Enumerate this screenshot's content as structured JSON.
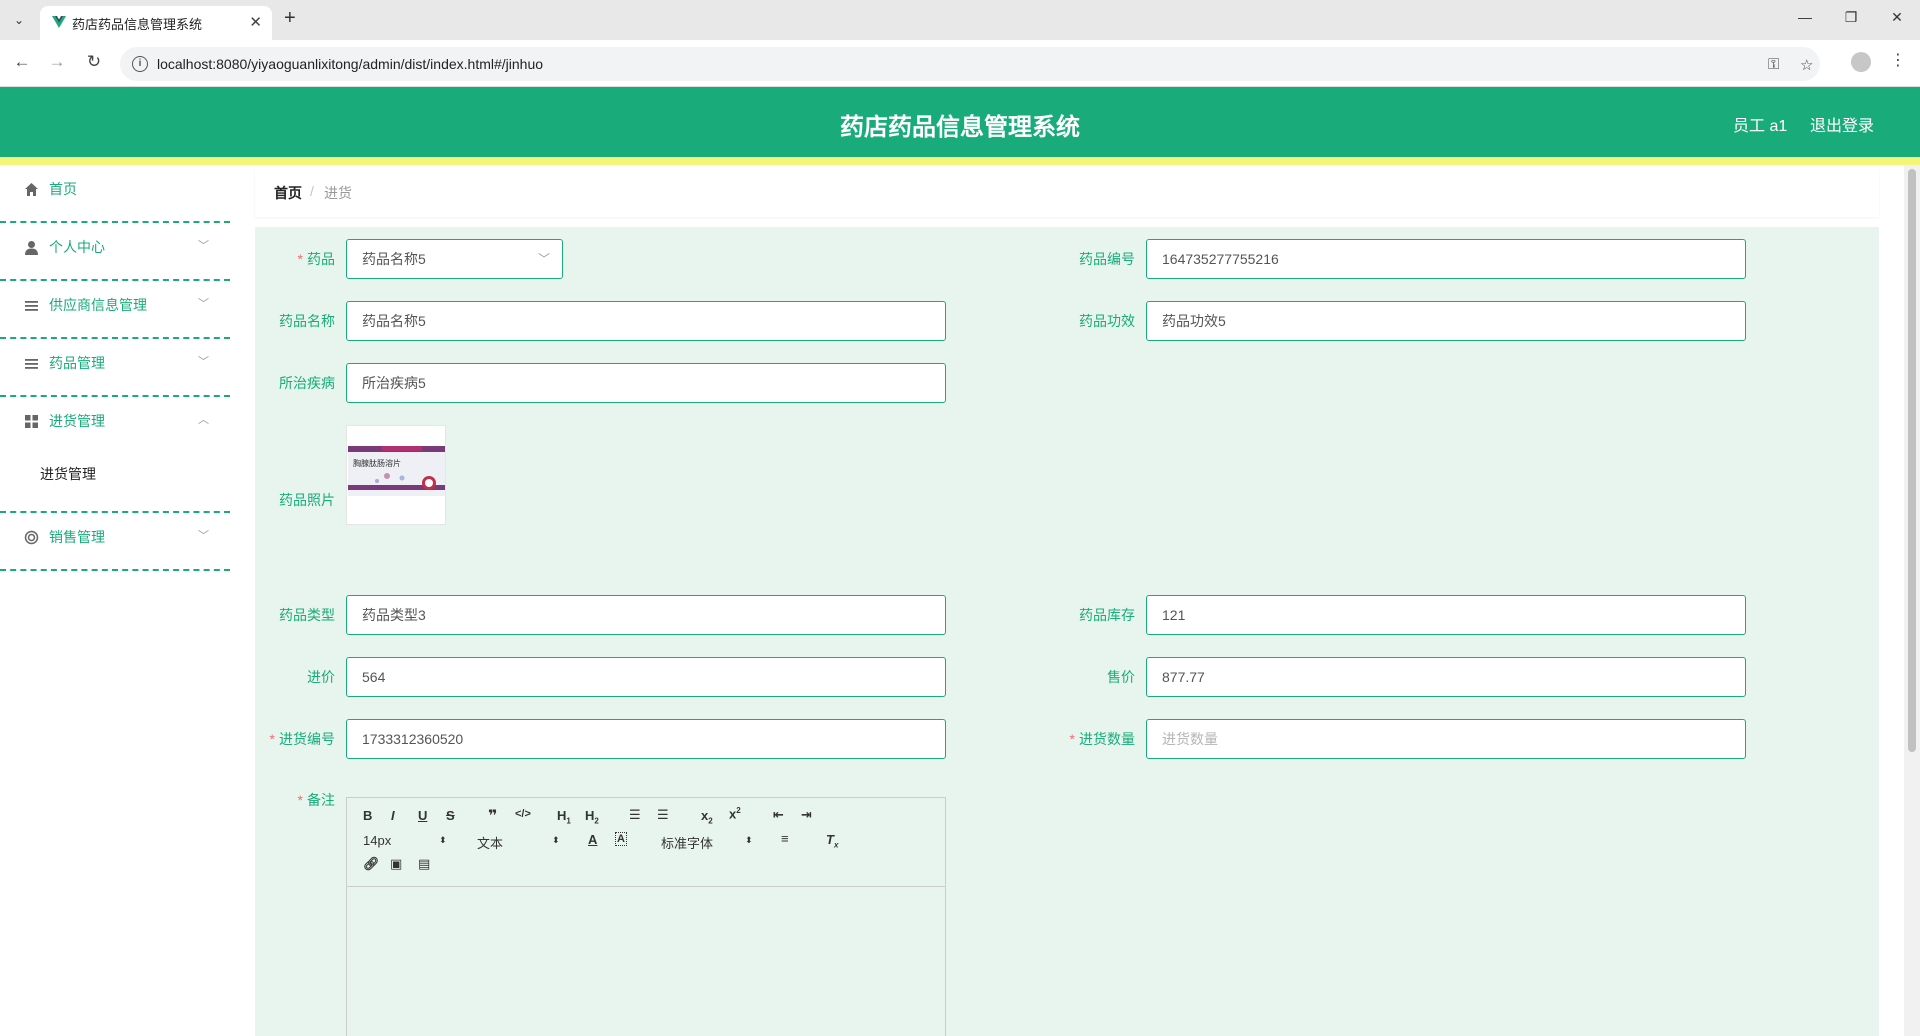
{
  "browser": {
    "tab_title": "药店药品信息管理系统",
    "url": "localhost:8080/yiyaoguanlixitong/admin/dist/index.html#/jinhuo"
  },
  "header": {
    "title": "药店药品信息管理系统",
    "user": "员工 a1",
    "logout": "退出登录"
  },
  "sidebar": {
    "items": [
      {
        "label": "首页",
        "icon": "home-icon"
      },
      {
        "label": "个人中心",
        "icon": "user-icon"
      },
      {
        "label": "供应商信息管理",
        "icon": "menu-icon"
      },
      {
        "label": "药品管理",
        "icon": "menu-icon"
      },
      {
        "label": "进货管理",
        "icon": "grid-icon",
        "expanded": true
      },
      {
        "label": "销售管理",
        "icon": "circle-icon"
      }
    ],
    "submenu": {
      "label": "进货管理"
    }
  },
  "breadcrumb": {
    "home": "首页",
    "sep": "/",
    "current": "进货"
  },
  "form": {
    "drug": {
      "label": "药品",
      "value": "药品名称5"
    },
    "drug_no": {
      "label": "药品编号",
      "value": "164735277755216"
    },
    "drug_name": {
      "label": "药品名称",
      "value": "药品名称5"
    },
    "efficacy": {
      "label": "药品功效",
      "value": "药品功效5"
    },
    "disease": {
      "label": "所治疾病",
      "value": "所治疾病5"
    },
    "photo": {
      "label": "药品照片",
      "product_text": "胸腺肽肠溶片"
    },
    "drug_type": {
      "label": "药品类型",
      "value": "药品类型3"
    },
    "stock": {
      "label": "药品库存",
      "value": "121"
    },
    "cost": {
      "label": "进价",
      "value": "564"
    },
    "price": {
      "label": "售价",
      "value": "877.77"
    },
    "purchase_no": {
      "label": "进货编号",
      "value": "1733312360520"
    },
    "purchase_qty": {
      "label": "进货数量",
      "placeholder": "进货数量"
    },
    "remark": {
      "label": "备注"
    }
  },
  "editor": {
    "font_size": "14px",
    "text_style": "文本",
    "font_family": "标准字体"
  },
  "colors": {
    "primary": "#1aab7a",
    "stripe": "#f5f57a",
    "panel": "#e8f5ef"
  }
}
